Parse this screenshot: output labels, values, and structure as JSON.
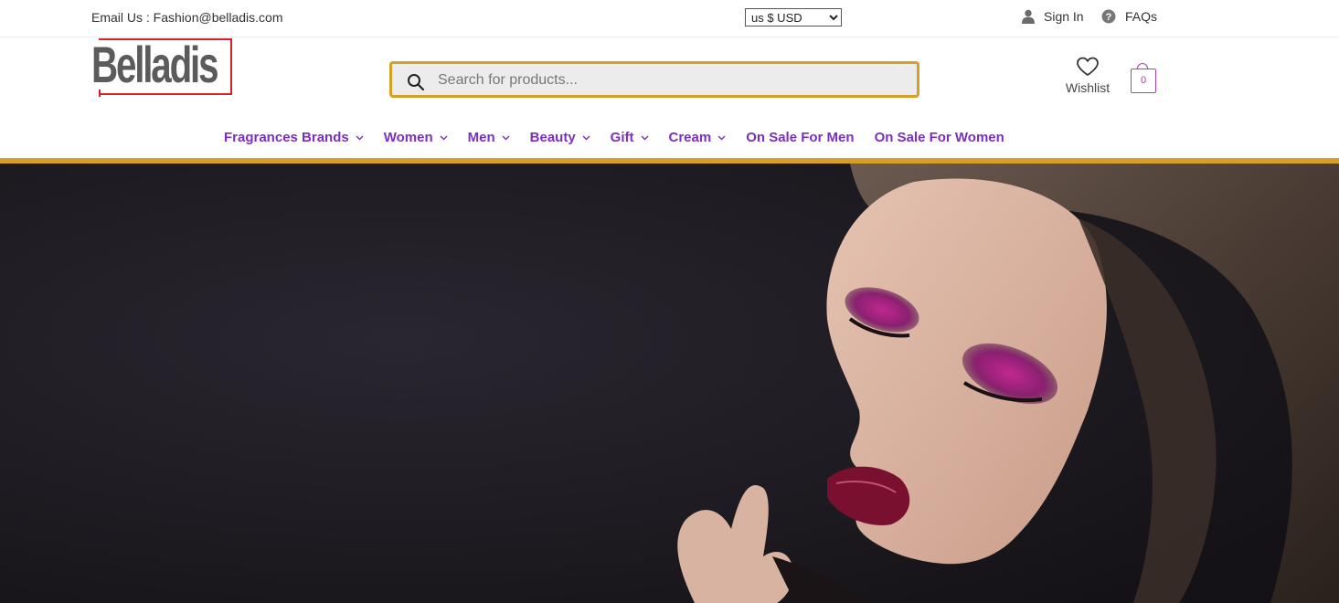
{
  "topbar": {
    "email": "Email Us : Fashion@belladis.com",
    "currency_options": [
      "us $ USD"
    ],
    "currency_selected": "us $ USD",
    "sign_in": "Sign In",
    "faqs": "FAQs"
  },
  "header": {
    "logo_text": "Belladis",
    "search_placeholder": "Search for products...",
    "wishlist_label": "Wishlist",
    "cart_count": "0"
  },
  "nav": {
    "items": [
      {
        "label": "Fragrances Brands",
        "has_dropdown": true
      },
      {
        "label": "Women",
        "has_dropdown": true
      },
      {
        "label": "Men",
        "has_dropdown": true
      },
      {
        "label": "Beauty",
        "has_dropdown": true
      },
      {
        "label": "Gift",
        "has_dropdown": true
      },
      {
        "label": "Cream",
        "has_dropdown": true
      },
      {
        "label": "On Sale For Men",
        "has_dropdown": false
      },
      {
        "label": "On Sale For Women",
        "has_dropdown": false
      }
    ]
  },
  "colors": {
    "accent_gold": "#d4a027",
    "nav_purple": "#7b2fbf",
    "logo_red": "#d2232a",
    "logo_gray": "#5b5b5b",
    "cart_magenta": "#b040b0"
  },
  "icons": [
    "user-icon",
    "help-circle-icon",
    "search-icon",
    "heart-icon",
    "shopping-bag-icon",
    "chevron-down-icon"
  ]
}
